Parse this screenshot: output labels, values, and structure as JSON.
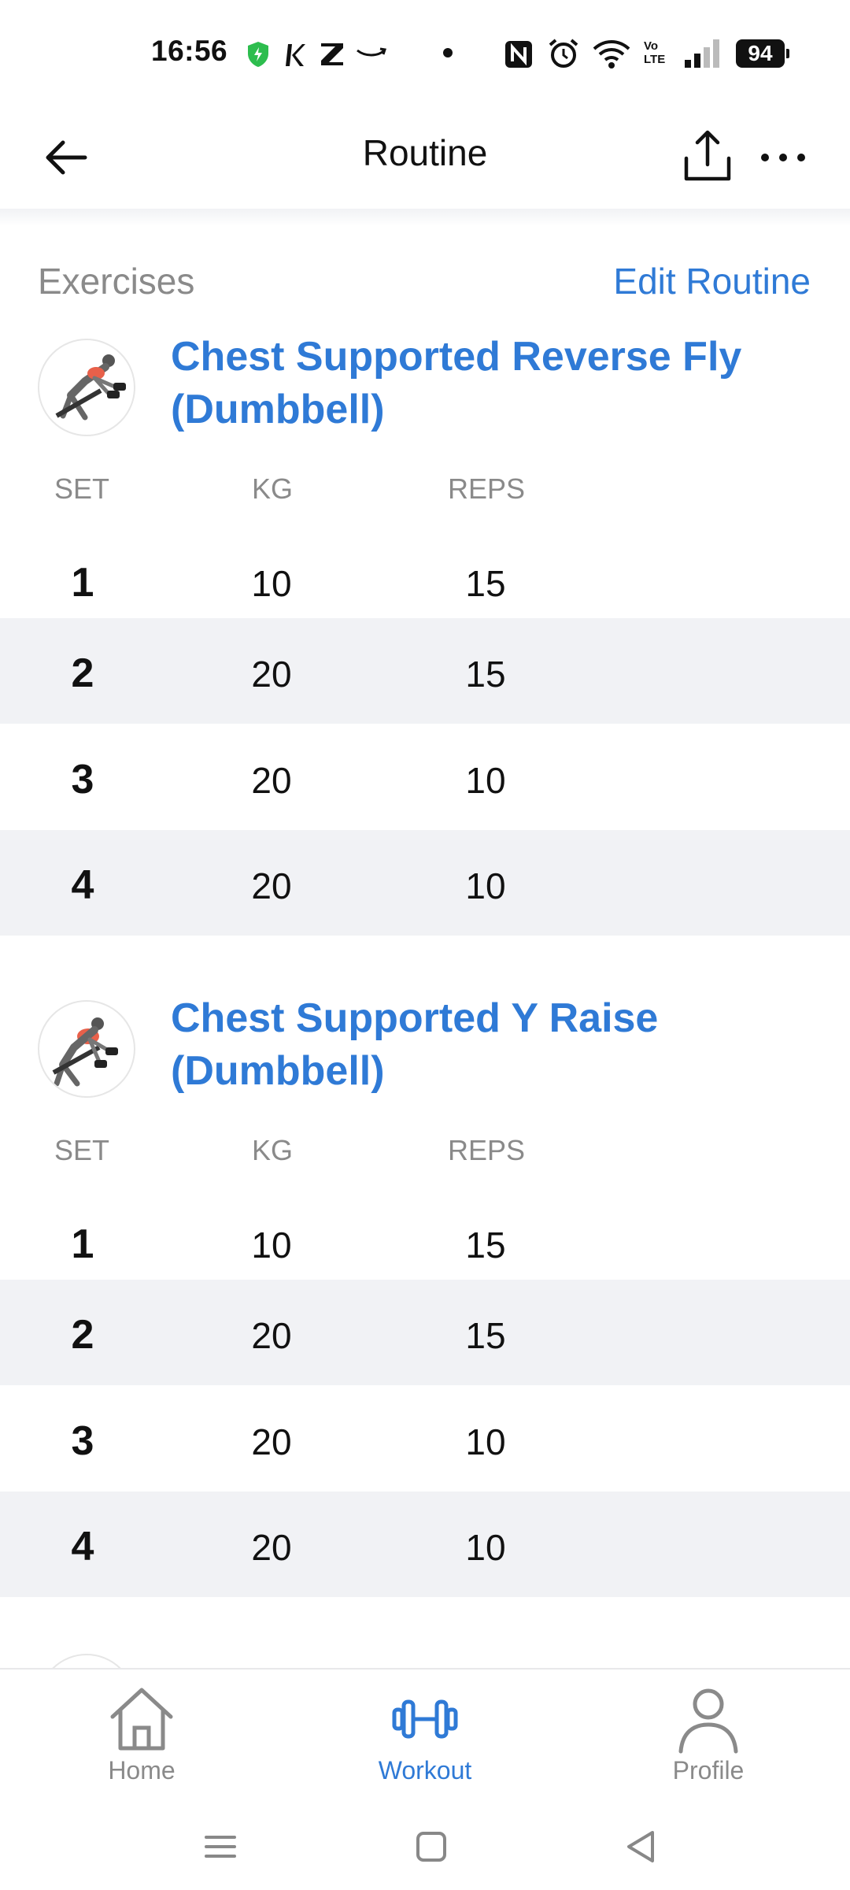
{
  "status_bar": {
    "time": "16:56",
    "battery": "94",
    "network_label": "Vo LTE"
  },
  "header": {
    "title": "Routine"
  },
  "section": {
    "label": "Exercises",
    "edit_label": "Edit Routine"
  },
  "columns": {
    "set": "SET",
    "kg": "KG",
    "reps": "REPS"
  },
  "exercises": [
    {
      "title_line1": "Chest Supported Reverse Fly",
      "title_line2": "(Dumbbell)",
      "sets": [
        {
          "set": "1",
          "kg": "10",
          "reps": "15"
        },
        {
          "set": "2",
          "kg": "20",
          "reps": "15"
        },
        {
          "set": "3",
          "kg": "20",
          "reps": "10"
        },
        {
          "set": "4",
          "kg": "20",
          "reps": "10"
        }
      ]
    },
    {
      "title_line1": "Chest Supported Y Raise",
      "title_line2": "(Dumbbell)",
      "sets": [
        {
          "set": "1",
          "kg": "10",
          "reps": "15"
        },
        {
          "set": "2",
          "kg": "20",
          "reps": "15"
        },
        {
          "set": "3",
          "kg": "20",
          "reps": "10"
        },
        {
          "set": "4",
          "kg": "20",
          "reps": "10"
        }
      ]
    }
  ],
  "bottom_nav": {
    "items": [
      {
        "label": "Home",
        "icon": "home-icon",
        "active": false
      },
      {
        "label": "Workout",
        "icon": "dumbbell-icon",
        "active": true
      },
      {
        "label": "Profile",
        "icon": "profile-icon",
        "active": false
      }
    ]
  },
  "colors": {
    "accent": "#2f7ad6",
    "muted": "#8a8a8a",
    "row_alt": "#f1f2f5"
  }
}
